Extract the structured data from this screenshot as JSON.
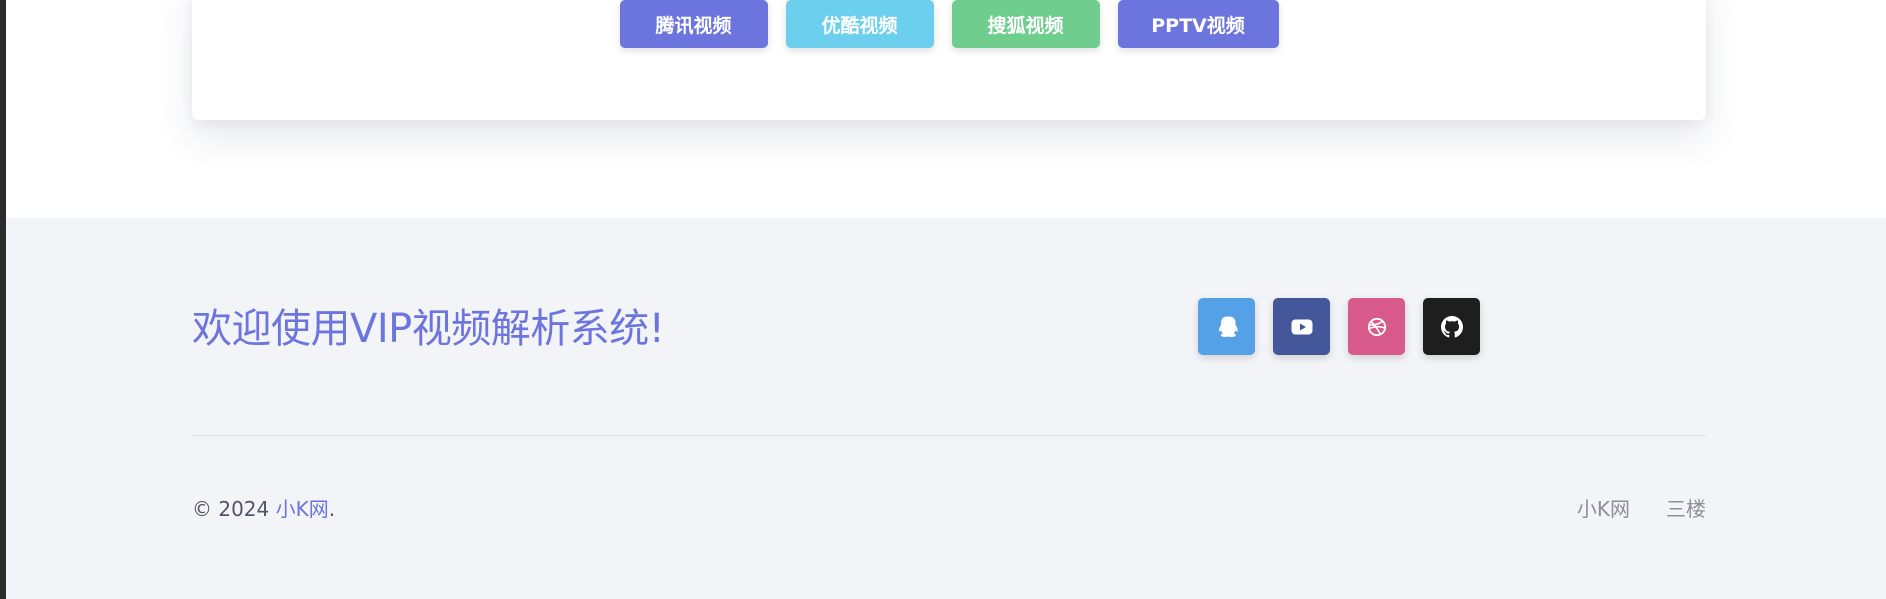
{
  "buttons": [
    {
      "label": "腾讯视频",
      "color": "#6c75de"
    },
    {
      "label": "优酷视频",
      "color": "#6ccfee"
    },
    {
      "label": "搜狐视频",
      "color": "#6fcd8e"
    },
    {
      "label": "PPTV视频",
      "color": "#6c75de"
    }
  ],
  "footer": {
    "welcome": "欢迎使用VIP视频解析系统!",
    "socials": [
      {
        "icon": "qq-icon",
        "color": "#55a1e8"
      },
      {
        "icon": "youtube-icon",
        "color": "#44579b"
      },
      {
        "icon": "dribbble-icon",
        "color": "#d75a8a"
      },
      {
        "icon": "github-icon",
        "color": "#1e1e1e"
      }
    ],
    "copyright_prefix": "© 2024 ",
    "copyright_link": "小K网",
    "copyright_suffix": ".",
    "links": [
      "小K网",
      "三楼"
    ]
  },
  "colors": {
    "accent": "#6c75de",
    "footer_bg": "#f3f4f7"
  }
}
